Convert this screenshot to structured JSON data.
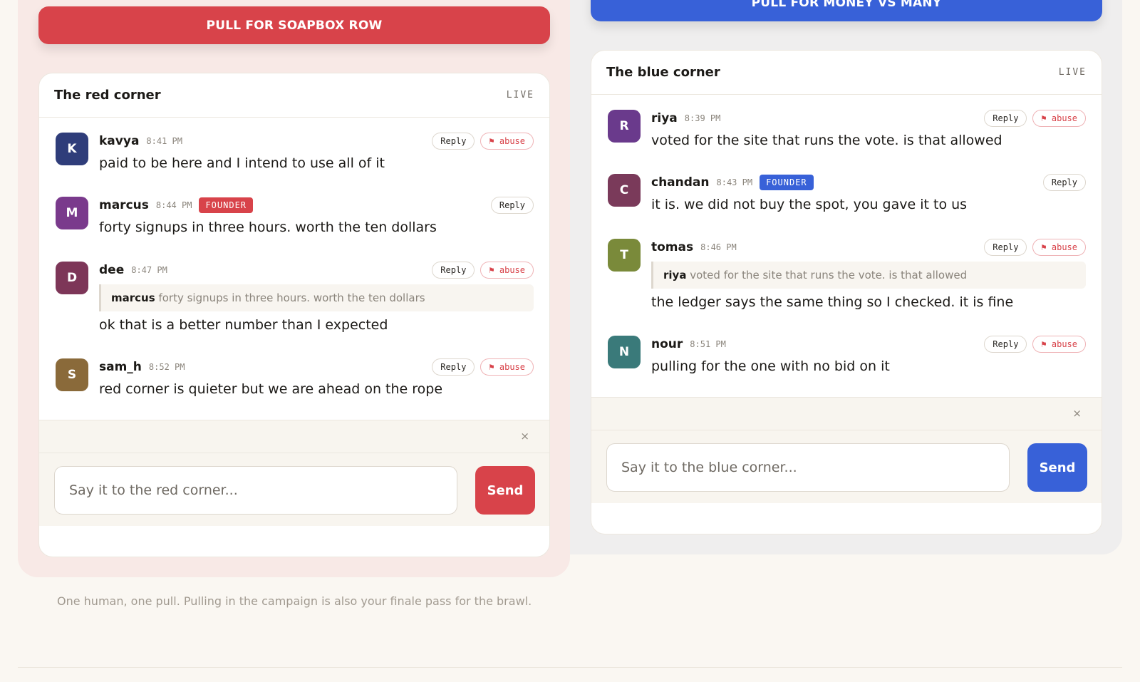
{
  "red": {
    "pull_label": "PULL FOR SOAPBOX ROW",
    "title": "The red corner",
    "live": "LIVE",
    "messages": [
      {
        "initial": "K",
        "user": "kavya",
        "time": "8:41 PM",
        "text": "paid to be here and I intend to use all of it",
        "reply": "Reply",
        "abuse": "⚑ abuse"
      },
      {
        "initial": "M",
        "user": "marcus",
        "time": "8:44 PM",
        "badge": "FOUNDER",
        "text": "forty signups in three hours. worth the ten dollars",
        "reply": "Reply"
      },
      {
        "initial": "D",
        "user": "dee",
        "time": "8:47 PM",
        "quote_user": "marcus",
        "quote_text": "forty signups in three hours. worth the ten dollars",
        "text": "ok that is a better number than I expected",
        "reply": "Reply",
        "abuse": "⚑ abuse"
      },
      {
        "initial": "S",
        "user": "sam_h",
        "time": "8:52 PM",
        "text": "red corner is quieter but we are ahead on the rope",
        "reply": "Reply",
        "abuse": "⚑ abuse"
      }
    ],
    "close": "×",
    "placeholder": "Say it to the red corner...",
    "send": "Send"
  },
  "blue": {
    "pull_label": "PULL FOR MONEY VS MANY",
    "title": "The blue corner",
    "live": "LIVE",
    "messages": [
      {
        "initial": "R",
        "user": "riya",
        "time": "8:39 PM",
        "text": "voted for the site that runs the vote. is that allowed",
        "reply": "Reply",
        "abuse": "⚑ abuse"
      },
      {
        "initial": "C",
        "user": "chandan",
        "time": "8:43 PM",
        "badge": "FOUNDER",
        "text": "it is. we did not buy the spot, you gave it to us",
        "reply": "Reply"
      },
      {
        "initial": "T",
        "user": "tomas",
        "time": "8:46 PM",
        "quote_user": "riya",
        "quote_text": "voted for the site that runs the vote. is that allowed",
        "text": "the ledger says the same thing so I checked. it is fine",
        "reply": "Reply",
        "abuse": "⚑ abuse"
      },
      {
        "initial": "N",
        "user": "nour",
        "time": "8:51 PM",
        "text": "pulling for the one with no bid on it",
        "reply": "Reply",
        "abuse": "⚑ abuse"
      }
    ],
    "close": "×",
    "placeholder": "Say it to the blue corner...",
    "send": "Send"
  },
  "footnote": "One human, one pull. Pulling in the campaign is also your finale pass for the brawl.",
  "colors": {
    "red_accent": "#d8434a",
    "blue_accent": "#3861d8",
    "avatars": [
      "#2f3d7a",
      "#7a3a8c",
      "#7d3658",
      "#8a6a3a",
      "#6a3a8c",
      "#7a3a5a",
      "#7a8a3a",
      "#3a7a7a"
    ]
  }
}
